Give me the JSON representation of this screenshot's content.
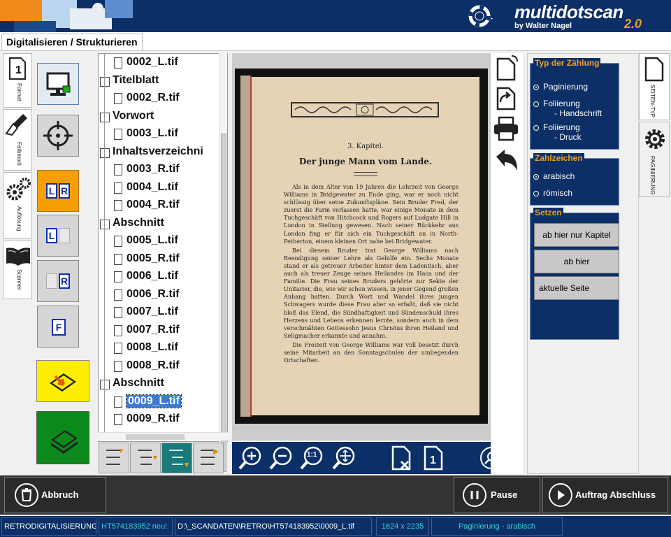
{
  "header": {
    "brand_name": "multidotscan",
    "brand_author": "by Walter Nagel",
    "brand_version": "2.0",
    "help_icon": "lifebuoy-icon"
  },
  "window": {
    "title": "Digitalisieren / Strukturieren"
  },
  "left_tabs": [
    {
      "label": "Format",
      "icon": "page-one-icon"
    },
    {
      "label": "Farbmodi",
      "icon": "brush-icon"
    },
    {
      "label": "Auflösung",
      "icon": "gears-icon"
    },
    {
      "label": "Scanner",
      "icon": "book-icon"
    }
  ],
  "tools": [
    {
      "name": "monitor-tool",
      "icon": "monitor-icon"
    },
    {
      "name": "crosshair-tool",
      "icon": "crosshair-icon"
    },
    {
      "name": "split-lr",
      "label_left": "L",
      "label_right": "R"
    },
    {
      "name": "split-l",
      "label": "L"
    },
    {
      "name": "split-r",
      "label": "R"
    },
    {
      "name": "split-f",
      "label": "F"
    }
  ],
  "tree": [
    {
      "type": "file",
      "indent": 1,
      "text": "0002_L.tif"
    },
    {
      "type": "section",
      "code": "T",
      "text": "Titelblatt"
    },
    {
      "type": "file",
      "indent": 1,
      "text": "0002_R.tif"
    },
    {
      "type": "section",
      "code": "VW",
      "text": "Vorwort"
    },
    {
      "type": "file",
      "indent": 1,
      "text": "0003_L.tif"
    },
    {
      "type": "section",
      "code": "I",
      "text": "Inhaltsverzeichni"
    },
    {
      "type": "file",
      "indent": 1,
      "text": "0003_R.tif"
    },
    {
      "type": "file",
      "indent": 1,
      "text": "0004_L.tif"
    },
    {
      "type": "file",
      "indent": 1,
      "text": "0004_R.tif"
    },
    {
      "type": "section",
      "code": "A",
      "text": "Abschnitt"
    },
    {
      "type": "file",
      "indent": 1,
      "text": "0005_L.tif"
    },
    {
      "type": "file",
      "indent": 1,
      "text": "0005_R.tif"
    },
    {
      "type": "file",
      "indent": 1,
      "text": "0006_L.tif"
    },
    {
      "type": "file",
      "indent": 1,
      "text": "0006_R.tif"
    },
    {
      "type": "file",
      "indent": 1,
      "text": "0007_L.tif"
    },
    {
      "type": "file",
      "indent": 1,
      "text": "0007_R.tif"
    },
    {
      "type": "file",
      "indent": 1,
      "text": "0008_L.tif"
    },
    {
      "type": "file",
      "indent": 1,
      "text": "0008_R.tif"
    },
    {
      "type": "section",
      "code": "A",
      "text": "Abschnitt"
    },
    {
      "type": "file",
      "indent": 1,
      "text": "0009_L.tif",
      "selected": true
    },
    {
      "type": "file",
      "indent": 1,
      "text": "0009_R.tif"
    }
  ],
  "document": {
    "chapter": "3. Kapitel.",
    "heading": "Der junge Mann vom Lande.",
    "paragraphs": [
      "Als in dem Alter von 19 Jahren die Lehrzeit von George Williams in Bridgewater zu Ende ging, war er noch nicht schlüssig über seine Zukunftspläne. Sein Bruder Fred, der zuerst die Farm verlassen hatte, war einige Monate in dem Tuchgeschäft von Hitchcock und Rogers auf Ludgate Hill in London in Stellung gewesen. Nach seiner Rückkehr aus London fing er für sich ein Tuchgeschäft an in North-Petherton, einem kleinen Ort nahe bei Bridgewater.",
      "Bei diesem Bruder trat George Williams nach Beendigung seiner Lehre als Gehilfe ein. Sechs Monate stand er als getreuer Arbeiter hinter dem Ladentisch, aber auch als treuer Zeuge seines Heilandes im Haus und der Familie. Die Frau seines Bruders gehörte zur Sekte der Unitarier, die, wie wir schon wissen, in jener Gegend großen Anhang hatten. Durch Wort und Wandel ihres jungen Schwagers wurde diese Frau aber so erfaßt, daß sie nicht bloß das Elend, die Sündhaftigkeit und Sündenschuld ihres Herzens und Lebens erkennen lernte, sondern auch in dem verschmähten Gottessohn Jesus Christus ihren Heiland und Seligmacher erkannte und annahm.",
      "Die Freizeit von George Williams war voll besetzt durch seine Mitarbeit an den Sonntagschulen der umliegenden Ortschaften."
    ]
  },
  "viewer_toolbar": [
    {
      "name": "zoom-in-button",
      "icon": "zoom-in-icon"
    },
    {
      "name": "zoom-out-button",
      "icon": "zoom-out-icon"
    },
    {
      "name": "zoom-actual-button",
      "icon": "zoom-actual-icon",
      "label": "1:1"
    },
    {
      "name": "zoom-fit-button",
      "icon": "zoom-fit-icon"
    },
    {
      "name": "delete-page-button",
      "icon": "page-delete-icon"
    },
    {
      "name": "page-one-button",
      "icon": "page-one-icon",
      "label": "1"
    },
    {
      "name": "search-button",
      "icon": "search-icon"
    }
  ],
  "side_icons": [
    {
      "name": "page-rotate-button",
      "icon": "page-rotate-icon"
    },
    {
      "name": "rotate-button",
      "icon": "rotate-arrow-icon"
    },
    {
      "name": "print-button",
      "icon": "printer-icon"
    },
    {
      "name": "undo-button",
      "icon": "undo-icon"
    }
  ],
  "right_panel": {
    "count_type": {
      "title": "Typ der Zählung",
      "options": [
        {
          "label": "Paginierung",
          "checked": true
        },
        {
          "label": "Foliierung",
          "sub": "- Handschrift",
          "checked": false
        },
        {
          "label": "Foliierung",
          "sub": "- Druck",
          "checked": false
        }
      ]
    },
    "numerals": {
      "title": "Zahlzeichen",
      "options": [
        {
          "label": "arabisch",
          "checked": true
        },
        {
          "label": "römisch",
          "checked": false
        }
      ]
    },
    "set": {
      "title": "Setzen",
      "buttons": [
        "ab hier nur Kapitel",
        "ab hier",
        "aktuelle Seite"
      ]
    }
  },
  "right_tabs": [
    {
      "label": "SEITEN-TYP",
      "icon": "page-icon"
    },
    {
      "label": "PAGINIERUNG",
      "icon": "gear-icon"
    }
  ],
  "actions": {
    "cancel": "Abbruch",
    "pause": "Pause",
    "finish": "Auftrag Abschluss"
  },
  "status": {
    "mode": "RETRODIGITALISIERUNG",
    "job": "HT574183952 neu!",
    "path": "D:\\_SCANDATEN\\RETRO\\HT574183952\\0009_L.tif",
    "dims": "1624 x 2235",
    "pagination": "Paginierung - arabisch"
  },
  "colors": {
    "header_bg": "#0b2f66",
    "accent_orange": "#f0a020",
    "lr_button": "#f5a000",
    "scan_yellow": "#ffee00",
    "scan_green": "#0a8a1a",
    "active_view": "#1a7a7a",
    "selection": "#3a7bd5"
  }
}
